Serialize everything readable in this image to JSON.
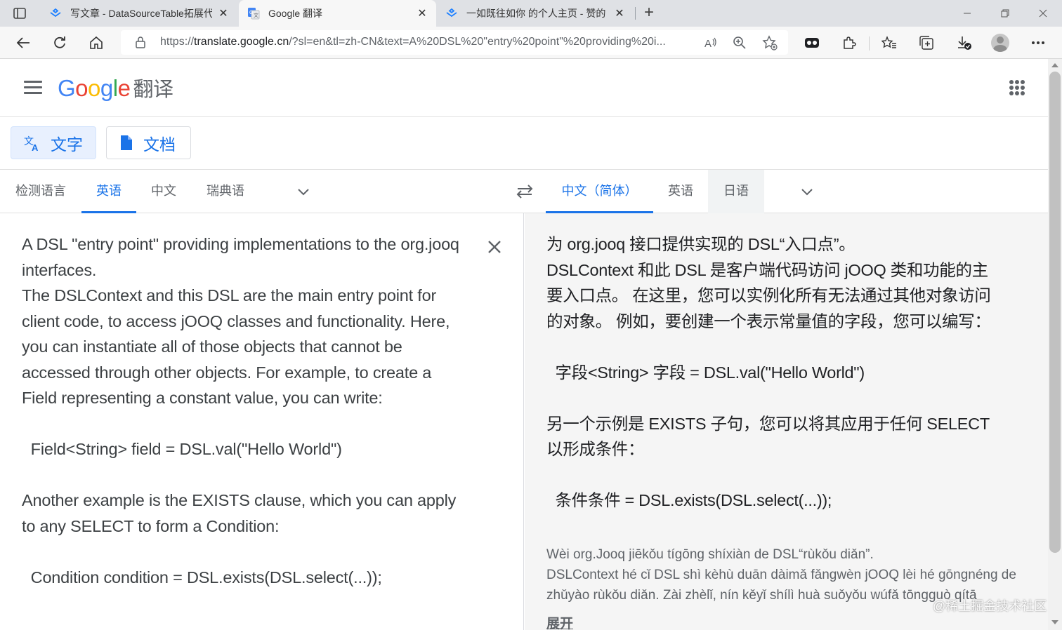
{
  "browser": {
    "tabs": [
      {
        "title": "写文章 - DataSourceTable拓展代",
        "close": "✕"
      },
      {
        "title": "Google 翻译",
        "close": "✕",
        "active": true
      },
      {
        "title": "一如既往如你 的个人主页 - 赞的",
        "close": "✕"
      }
    ],
    "new_tab": "+",
    "url_prefix": "https://",
    "url_host": "translate.google.cn",
    "url_rest": "/?sl=en&tl=zh-CN&text=A%20DSL%20\"entry%20point\"%20providing%20i..."
  },
  "header": {
    "logo_letters": [
      "G",
      "o",
      "o",
      "g",
      "l",
      "e"
    ],
    "product": "翻译"
  },
  "modes": {
    "text_label": "文字",
    "doc_label": "文档"
  },
  "source_langs": {
    "detect": "检测语言",
    "items": [
      "英语",
      "中文",
      "瑞典语"
    ]
  },
  "target_langs": {
    "items": [
      "中文（简体）",
      "英语",
      "日语"
    ]
  },
  "source": {
    "text": "A DSL \"entry point\" providing implementations to the org.jooq\ninterfaces.\nThe DSLContext and this DSL are the main entry point for\nclient code, to access jOOQ classes and functionality. Here,\nyou can instantiate all of those objects that cannot be\naccessed through other objects. For example, to create a\nField representing a constant value, you can write:\n\n  Field<String> field = DSL.val(\"Hello World\")\n\nAnother example is the EXISTS clause, which you can apply\nto any SELECT to form a Condition:\n\n  Condition condition = DSL.exists(DSL.select(...));"
  },
  "target": {
    "text": "为 org.jooq 接口提供实现的 DSL“入口点”。\nDSLContext 和此 DSL 是客户端代码访问 jOOQ 类和功能的主\n要入口点。 在这里，您可以实例化所有无法通过其他对象访问\n的对象。 例如，要创建一个表示常量值的字段，您可以编写：\n\n  字段<String> 字段 = DSL.val(\"Hello World\")\n\n另一个示例是 EXISTS 子句，您可以将其应用于任何 SELECT\n以形成条件：\n\n  条件条件 = DSL.exists(DSL.select(...));",
    "transliteration": "Wèi org.Jooq jiēkǒu tígōng shíxiàn de DSL“rùkǒu diǎn”.\nDSLContext hé cǐ DSL shì kèhù duān dàimǎ fǎngwèn jOOQ lèi hé gōngnéng de\nzhǔyào rùkǒu diǎn. Zài zhèlǐ, nín kěyǐ shílì huà suǒyǒu wúfǎ tōngguò qítā",
    "expand": "展开"
  },
  "watermark": "@稀土掘金技术社区",
  "colors": {
    "accent": "#1a73e8",
    "selected_bg": "#e8f0fe",
    "target_bg": "#f5f5f5"
  }
}
